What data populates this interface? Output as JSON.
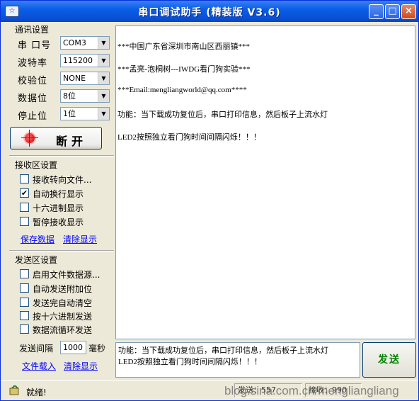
{
  "window": {
    "title": "串口调试助手 (精装版 V3.6)",
    "icon_text": "☆",
    "min_label": "_",
    "max_label": "□",
    "close_label": "×"
  },
  "serial": {
    "group_title": "通讯设置",
    "port_label": "串 口号",
    "port_value": "COM3",
    "baud_label": "波特率",
    "baud_value": "115200",
    "parity_label": "校验位",
    "parity_value": "NONE",
    "databits_label": "数据位",
    "databits_value": "8位",
    "stopbits_label": "停止位",
    "stopbits_value": "1位",
    "disconnect_label": "断开"
  },
  "receive": {
    "group_title": "接收区设置",
    "options": [
      {
        "label": "接收转向文件...",
        "checked": false
      },
      {
        "label": "自动换行显示",
        "checked": true
      },
      {
        "label": "十六进制显示",
        "checked": false
      },
      {
        "label": "暂停接收显示",
        "checked": false
      }
    ],
    "save_link": "保存数据",
    "clear_link": "清除显示"
  },
  "send": {
    "group_title": "发送区设置",
    "options": [
      {
        "label": "启用文件数据源...",
        "checked": false
      },
      {
        "label": "自动发送附加位",
        "checked": false
      },
      {
        "label": "发送完自动清空",
        "checked": false
      },
      {
        "label": "按十六进制发送",
        "checked": false
      },
      {
        "label": "数据流循环发送",
        "checked": false
      }
    ],
    "interval_label": "发送间隔",
    "interval_value": "1000",
    "interval_unit": "毫秒",
    "file_link": "文件载入",
    "clear_link": "清除显示",
    "send_button": "发送"
  },
  "receive_area": {
    "lines": [
      "***中国广东省深圳市南山区西丽镇***",
      "***孟亮-泡桐树---IWDG看门狗实验***",
      "***Email:mengliangworld@qq.com****",
      "功能：当下载成功复位后，串口打印信息，然后板子上流水灯",
      "LED2按照独立看门狗时间间隔闪烁！！！"
    ]
  },
  "send_area": {
    "lines": [
      "功能：当下载成功复位后，串口打印信息，然后板子上流水灯",
      "LED2按照独立看门狗时间间隔闪烁！！！"
    ]
  },
  "status": {
    "ready_text": "就绪!",
    "sent_text": "发送：557",
    "recv_text": "接收：990",
    "watermark": "blog.sina.com.cn/mengliangliang"
  }
}
